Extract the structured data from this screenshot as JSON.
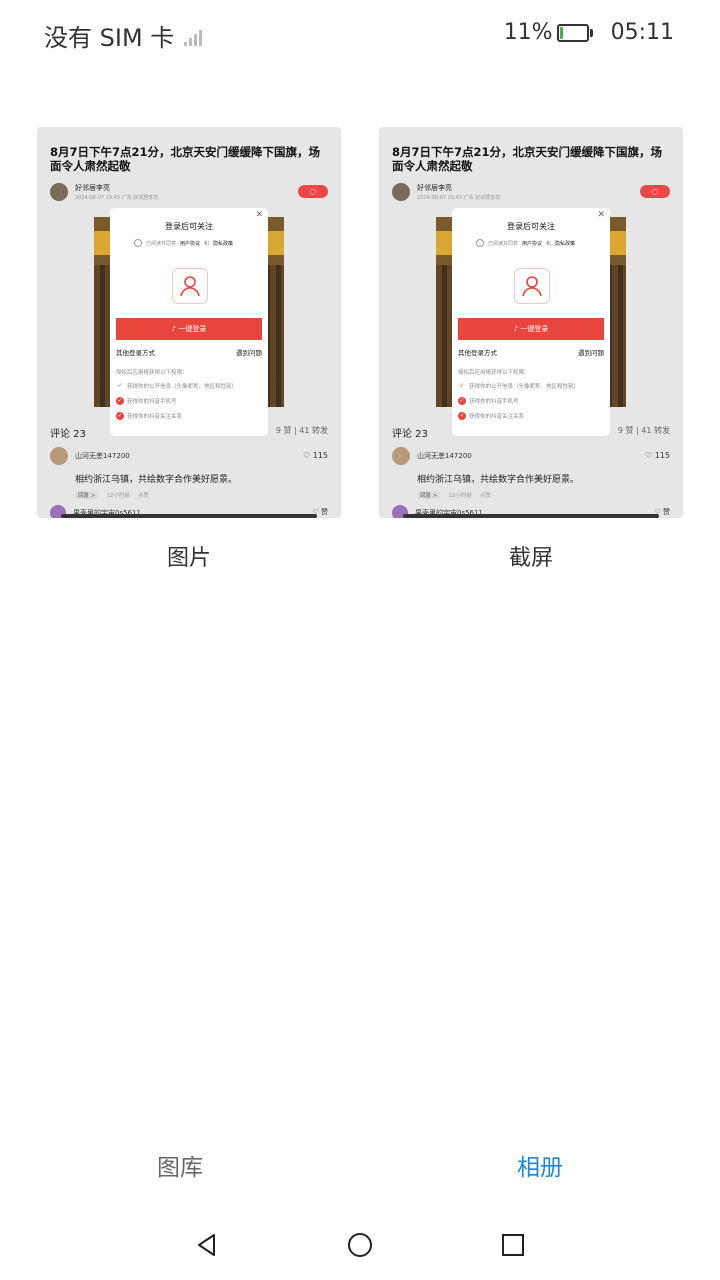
{
  "status_bar": {
    "carrier": "没有 SIM 卡",
    "battery_percent": "11%",
    "battery_level": 0.11,
    "time": "05:11",
    "icons": [
      "no-signal-icon",
      "battery-icon"
    ]
  },
  "thumbnail": {
    "post_title": "8月7日下午7点21分，北京天安门缓缓降下国旗，场面令人肃然起敬",
    "author_name": "好邻居李亮",
    "author_meta": "2024-08-07 19:43 广东 好邻居李亮",
    "comments_label": "评论 23",
    "stats": "9 赞 | 41 转发",
    "comment1_user": "山河无恙147200",
    "comment1_likes": "115",
    "comment1_text": "相约浙江乌镇，共绘数字合作美好愿景。",
    "comment1_tag": "回复 >",
    "comment1_time": "12小时前",
    "comment1_extra": "点赞",
    "comment2_user": "果壳里的宇宙0s5611",
    "comment2_likes": "赞",
    "modal": {
      "title": "登录后可关注",
      "agree_prefix": "已阅读并同意",
      "agree_terms": "用户协议",
      "agree_and": "和",
      "agree_privacy": "隐私政策",
      "login_button": "一键登录",
      "other_login": "其他登录方式",
      "issues": "遇到问题",
      "perm_header": "授权后应用将获得以下权限：",
      "perms": [
        "获得你的公开信息（头像昵称、地区和性别）",
        "获得你的抖音手机号",
        "获得你的抖音关注关系"
      ]
    }
  },
  "albums": [
    {
      "label": "图片"
    },
    {
      "label": "截屏"
    }
  ],
  "tabs": {
    "gallery": "图库",
    "albums": "相册",
    "active": "albums",
    "active_color": "#1e88d2"
  },
  "nav": {
    "icons": [
      "back-icon",
      "home-icon",
      "recents-icon"
    ]
  }
}
